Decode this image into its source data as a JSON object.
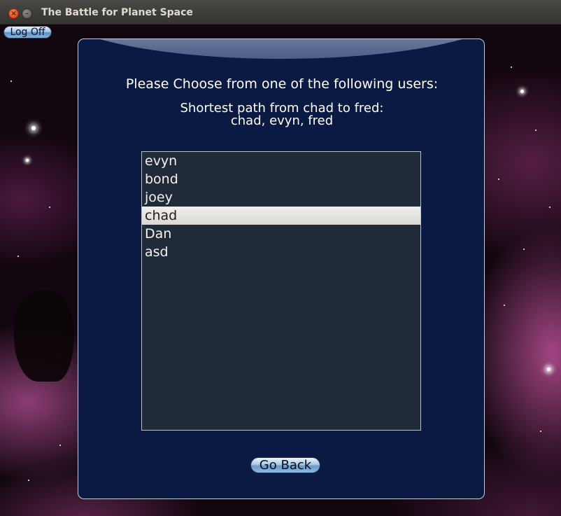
{
  "window": {
    "title": "The Battle for Planet Space",
    "close_glyph": "×",
    "minimize_glyph": "–"
  },
  "toolbar": {
    "logoff_label": "Log Off"
  },
  "panel": {
    "prompt": "Please Choose from one of the following users:",
    "path_title": "Shortest path from chad to fred:",
    "path_value": "chad, evyn, fred",
    "users": [
      {
        "name": "evyn",
        "selected": false
      },
      {
        "name": "bond",
        "selected": false
      },
      {
        "name": "joey",
        "selected": false
      },
      {
        "name": "chad",
        "selected": true
      },
      {
        "name": "Dan",
        "selected": false
      },
      {
        "name": "asd",
        "selected": false
      }
    ],
    "go_back_label": "Go Back"
  },
  "colors": {
    "panel_bg": "#0a1a42",
    "list_bg": "#212a38",
    "selected_row": "#e4e2df",
    "button_blue": "#8fb8df",
    "close_orange": "#e2531f"
  },
  "icons": [
    "close-icon",
    "minimize-icon"
  ]
}
